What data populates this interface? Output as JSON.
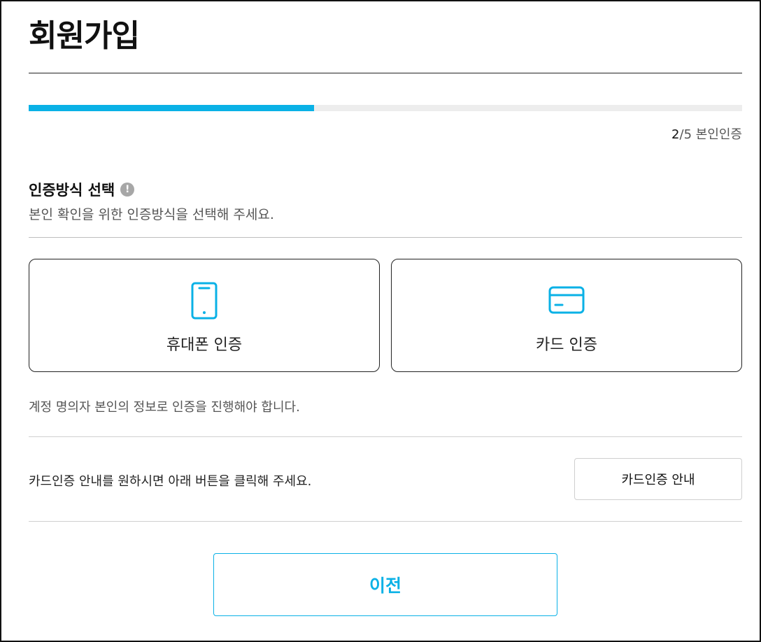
{
  "header": {
    "title": "회원가입"
  },
  "progress": {
    "current": "2",
    "total": "/5",
    "step_name": " 본인인증",
    "fraction": 0.4
  },
  "section": {
    "title": "인증방식 선택",
    "info_icon_glyph": "!",
    "description": "본인 확인을 위한 인증방식을 선택해 주세요."
  },
  "methods": [
    {
      "label": "휴대폰 인증",
      "icon": "smartphone-icon"
    },
    {
      "label": "카드 인증",
      "icon": "credit-card-icon"
    }
  ],
  "notice": "계정 명의자 본인의 정보로 인증을 진행해야 합니다.",
  "card_guide": {
    "text": "카드인증 안내를 원하시면 아래 버튼을 클릭해 주세요.",
    "button_label": "카드인증 안내"
  },
  "footer": {
    "prev_label": "이전"
  },
  "colors": {
    "accent": "#0ab1e6",
    "track": "#ededed"
  }
}
